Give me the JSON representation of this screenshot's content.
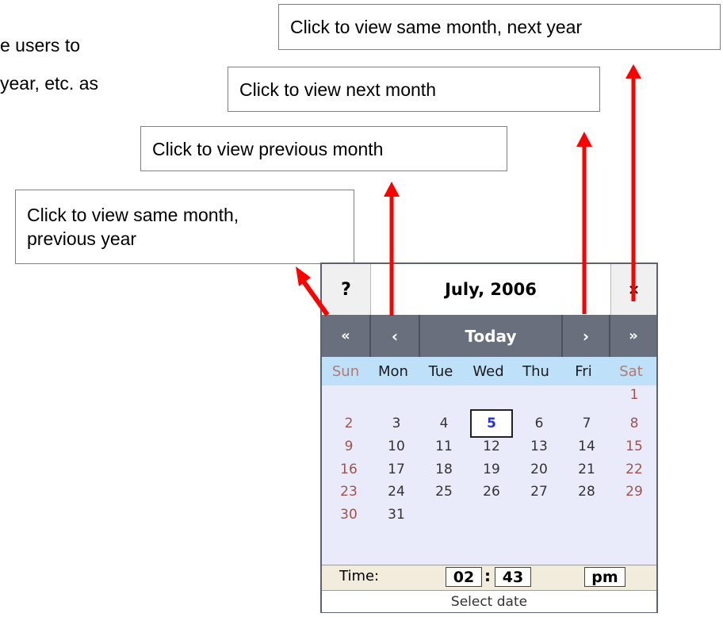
{
  "background_text": {
    "line1": "e users to",
    "line2": "year, etc. as"
  },
  "callouts": {
    "next_year": "Click to view same month, next year",
    "next_month": "Click to view next month",
    "prev_month": "Click to view previous month",
    "prev_year_line1": "Click to view same month,",
    "prev_year_line2": "previous year"
  },
  "colors": {
    "arrow": "#ff0000",
    "nav_bar": "#6a6f7d",
    "weekday_bar": "#bee0f8",
    "grid_bg": "#e9ebfa",
    "today_text": "#2233dd",
    "weekend_text": "#a0534a"
  },
  "calendar": {
    "help_label": "?",
    "title": "July, 2006",
    "close_label": "×",
    "nav": {
      "prev_year": "«",
      "prev_month": "‹",
      "today": "Today",
      "next_month": "›",
      "next_year": "»"
    },
    "weekdays": [
      "Sun",
      "Mon",
      "Tue",
      "Wed",
      "Thu",
      "Fri",
      "Sat"
    ],
    "weeks": [
      [
        "",
        "",
        "",
        "",
        "",
        "",
        "1"
      ],
      [
        "2",
        "3",
        "4",
        "5",
        "6",
        "7",
        "8"
      ],
      [
        "9",
        "10",
        "11",
        "12",
        "13",
        "14",
        "15"
      ],
      [
        "16",
        "17",
        "18",
        "19",
        "20",
        "21",
        "22"
      ],
      [
        "23",
        "24",
        "25",
        "26",
        "27",
        "28",
        "29"
      ],
      [
        "30",
        "31",
        "",
        "",
        "",
        "",
        ""
      ]
    ],
    "selected_day": "5",
    "time_label": "Time:",
    "hour": "02",
    "colon": ":",
    "minute": "43",
    "ampm": "pm",
    "footer": "Select date"
  }
}
